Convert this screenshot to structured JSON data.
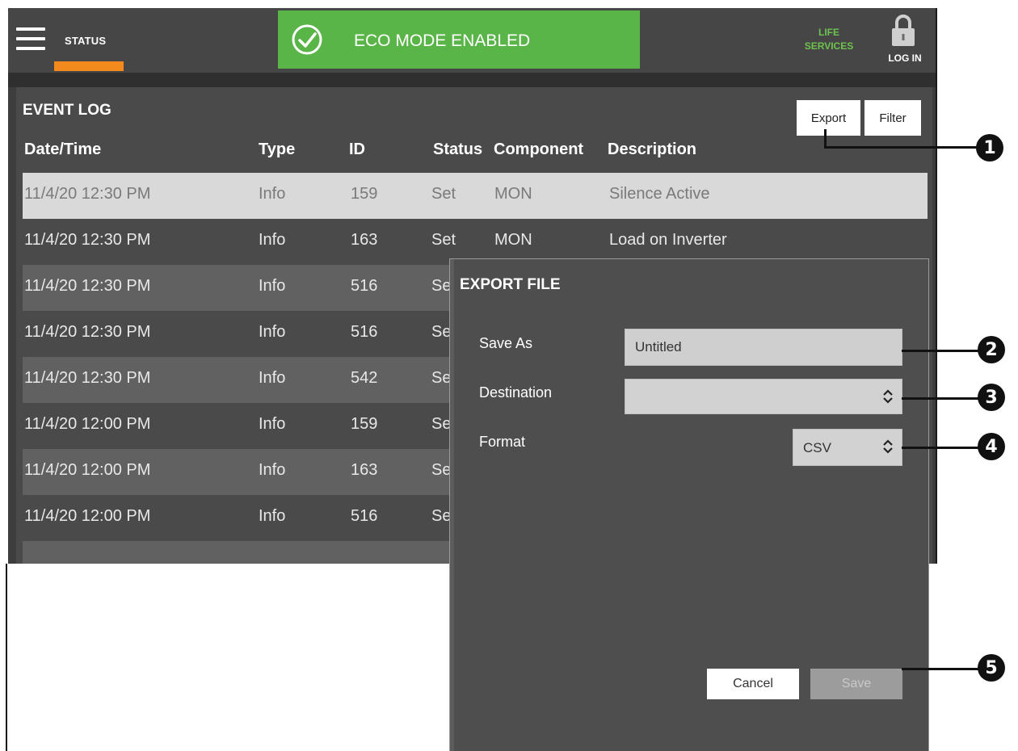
{
  "header": {
    "status_label": "STATUS",
    "eco_banner": "ECO MODE ENABLED",
    "life_services_line1": "LIFE",
    "life_services_line2": "SERVICES",
    "login_label": "LOG IN"
  },
  "event_log": {
    "title": "EVENT LOG",
    "export_label": "Export",
    "filter_label": "Filter",
    "columns": [
      "Date/Time",
      "Type",
      "ID",
      "Status",
      "Component",
      "Description"
    ],
    "rows": [
      {
        "datetime": "11/4/20 12:30 PM",
        "type": "Info",
        "id": "159",
        "status": "Set",
        "component": "MON",
        "description": "Silence Active"
      },
      {
        "datetime": "11/4/20 12:30 PM",
        "type": "Info",
        "id": "163",
        "status": "Set",
        "component": "MON",
        "description": "Load on Inverter"
      },
      {
        "datetime": "11/4/20 12:30 PM",
        "type": "Info",
        "id": "516",
        "status": "Se",
        "component": "",
        "description": ""
      },
      {
        "datetime": "11/4/20 12:30 PM",
        "type": "Info",
        "id": "516",
        "status": "Se",
        "component": "",
        "description": ""
      },
      {
        "datetime": "11/4/20 12:30 PM",
        "type": "Info",
        "id": "542",
        "status": "Se",
        "component": "",
        "description": ""
      },
      {
        "datetime": "11/4/20 12:00 PM",
        "type": "Info",
        "id": "159",
        "status": "Se",
        "component": "",
        "description": ""
      },
      {
        "datetime": "11/4/20 12:00 PM",
        "type": "Info",
        "id": "163",
        "status": "Se",
        "component": "",
        "description": ""
      },
      {
        "datetime": "11/4/20 12:00 PM",
        "type": "Info",
        "id": "516",
        "status": "Se",
        "component": "",
        "description": ""
      }
    ]
  },
  "export_dialog": {
    "title": "EXPORT FILE",
    "save_as_label": "Save As",
    "save_as_value": "Untitled",
    "destination_label": "Destination",
    "destination_value": "",
    "format_label": "Format",
    "format_value": "CSV",
    "cancel_label": "Cancel",
    "save_label": "Save"
  },
  "callouts": [
    "1",
    "2",
    "3",
    "4",
    "5"
  ],
  "colors": {
    "eco_green": "#5ab548",
    "status_accent": "#f28a1e",
    "life_services_green": "#6fc24f"
  },
  "icons": [
    "menu-icon",
    "check-circle-icon",
    "lock-icon",
    "chevron-updown-icon"
  ]
}
